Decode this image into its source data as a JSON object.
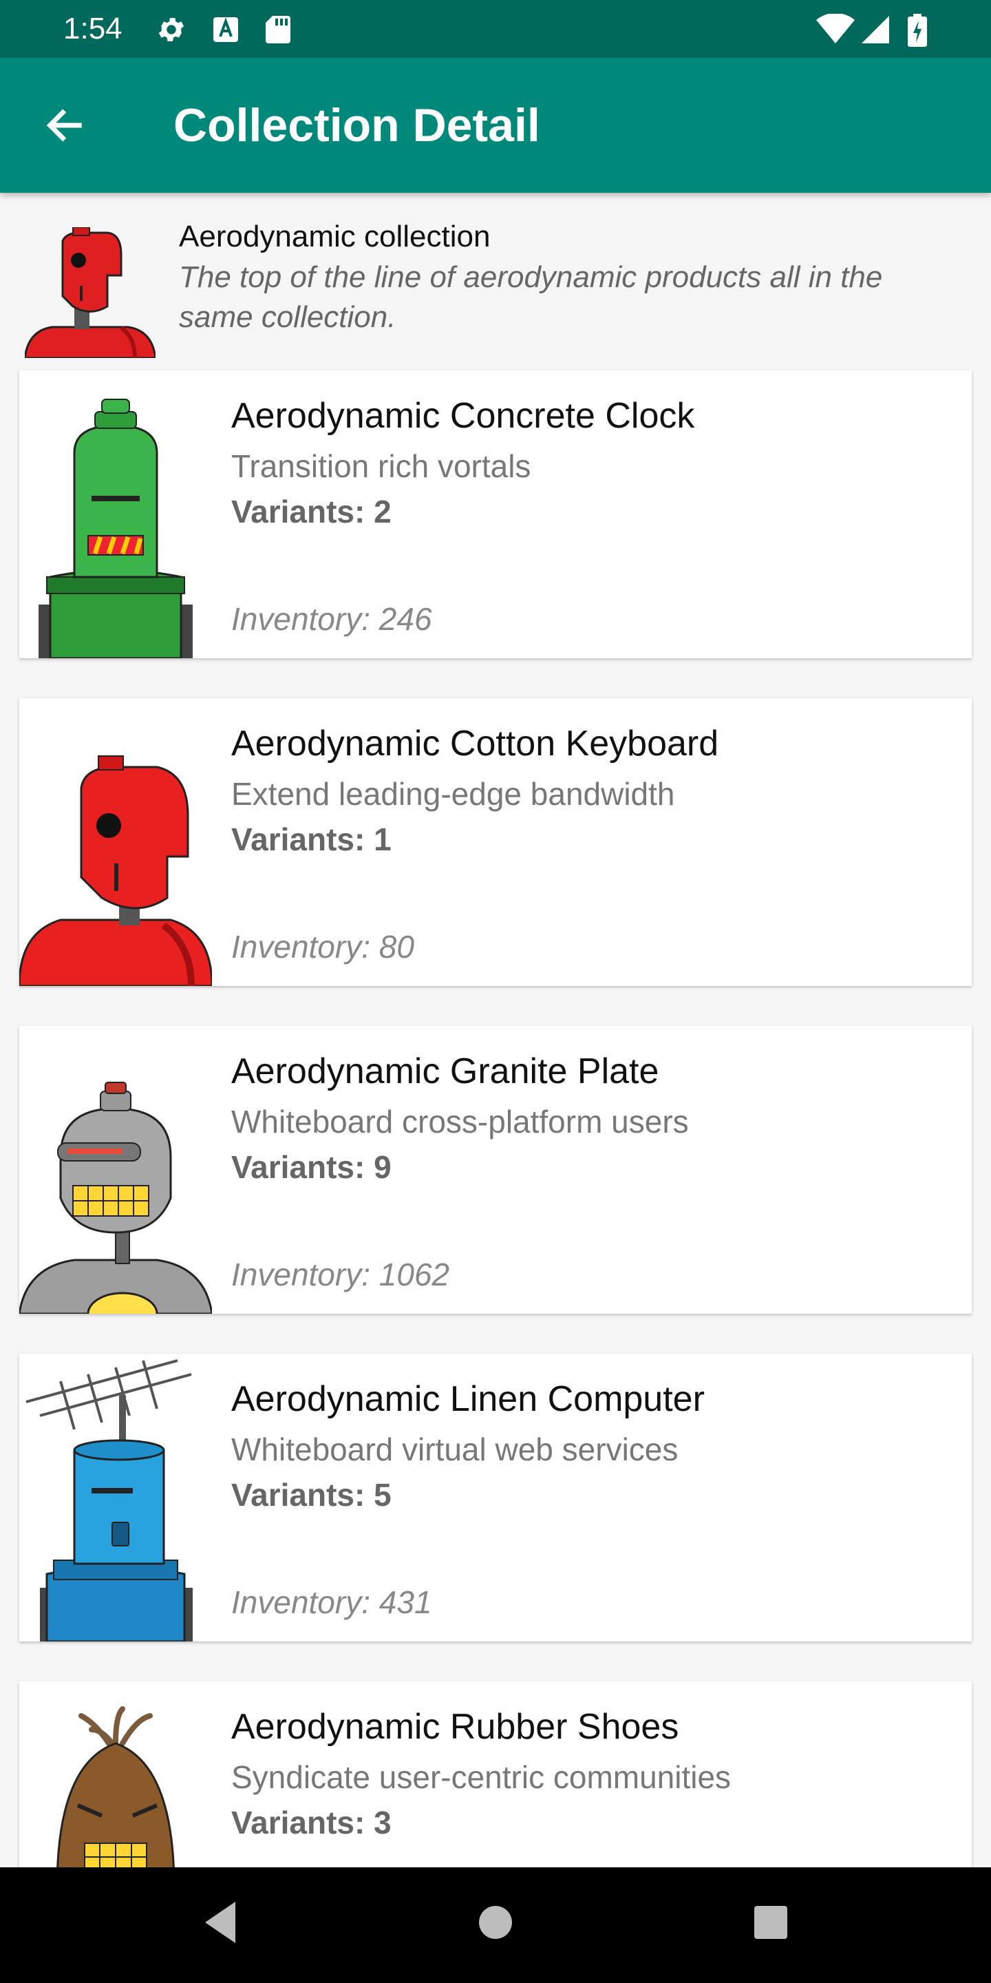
{
  "status_bar": {
    "time": "1:54",
    "icons": [
      "settings-icon",
      "keyboard-a-icon",
      "sd-card-icon",
      "wifi-icon",
      "cell-signal-icon",
      "battery-charging-icon"
    ]
  },
  "app_bar": {
    "back_icon": "arrow-back-icon",
    "title": "Collection Detail"
  },
  "collection": {
    "name": "Aerodynamic collection",
    "description": "The top of the line of aerodynamic products all in the same collection."
  },
  "products": [
    {
      "name": "Aerodynamic Concrete Clock",
      "tagline": "Transition rich vortals",
      "variants": "Variants: 2",
      "inventory": "Inventory: 246",
      "icon": "green-robot-icon"
    },
    {
      "name": "Aerodynamic Cotton Keyboard",
      "tagline": "Extend leading-edge bandwidth",
      "variants": "Variants: 1",
      "inventory": "Inventory: 80",
      "icon": "red-robot-icon"
    },
    {
      "name": "Aerodynamic Granite Plate",
      "tagline": "Whiteboard cross-platform users",
      "variants": "Variants: 9",
      "inventory": "Inventory: 1062",
      "icon": "gray-robot-icon"
    },
    {
      "name": "Aerodynamic Linen Computer",
      "tagline": "Whiteboard virtual web services",
      "variants": "Variants: 5",
      "inventory": "Inventory: 431",
      "icon": "blue-robot-icon"
    },
    {
      "name": "Aerodynamic Rubber Shoes",
      "tagline": "Syndicate user-centric communities",
      "variants": "Variants: 3",
      "inventory": "",
      "icon": "brown-robot-icon"
    }
  ],
  "nav_bar": {
    "icons": [
      "back-triangle-icon",
      "home-circle-icon",
      "recents-square-icon"
    ]
  },
  "colors": {
    "status_bar": "#00695c",
    "app_bar": "#00897b",
    "background": "#f5f5f5"
  }
}
